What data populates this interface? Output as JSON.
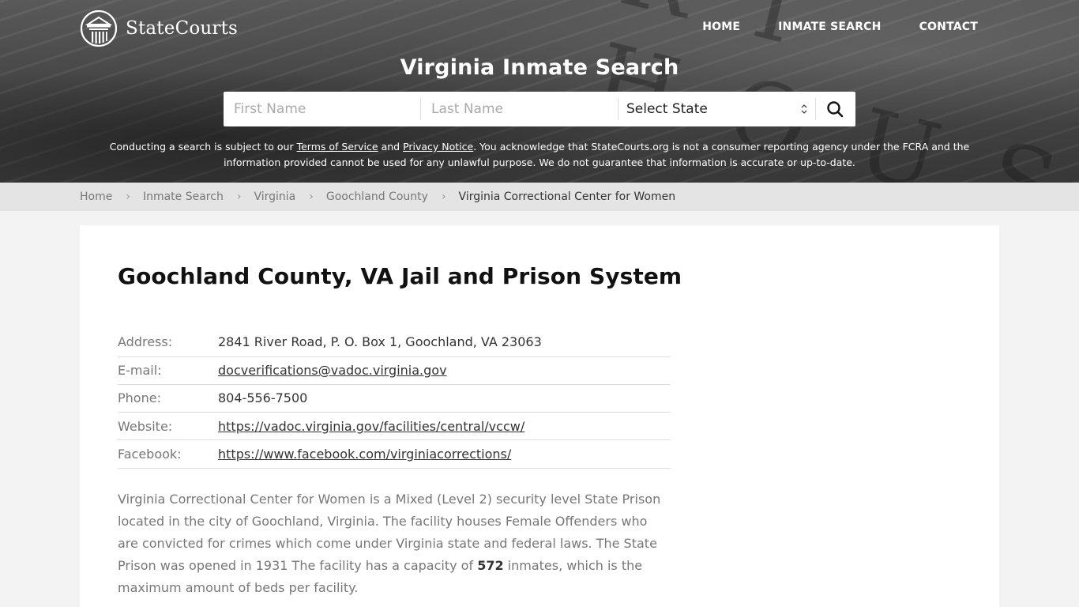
{
  "brand": {
    "name": "StateCourts",
    "logo_icon": "courthouse-columns-icon"
  },
  "nav": {
    "items": [
      {
        "label": "HOME"
      },
      {
        "label": "INMATE SEARCH"
      },
      {
        "label": "CONTACT"
      }
    ]
  },
  "hero": {
    "title": "Virginia Inmate Search",
    "decorative_text": "RT HOUSE"
  },
  "search": {
    "first_name_placeholder": "First Name",
    "first_name_value": "",
    "last_name_placeholder": "Last Name",
    "last_name_value": "",
    "state_selected": "Select State",
    "state_icon": "select-updown-icon",
    "search_icon": "search-icon"
  },
  "disclaimer": {
    "part1": "Conducting a search is subject to our ",
    "terms_link": "Terms of Service",
    "part2": " and ",
    "privacy_link": "Privacy Notice",
    "part3": ". You acknowledge that StateCourts.org is not a consumer reporting agency under the FCRA and the information provided cannot be used for any unlawful purpose. We do not guarantee that information is accurate or up-to-date."
  },
  "breadcrumb": {
    "items": [
      {
        "label": "Home"
      },
      {
        "label": "Inmate Search"
      },
      {
        "label": "Virginia"
      },
      {
        "label": "Goochland County"
      }
    ],
    "current": "Virginia Correctional Center for Women",
    "separator_icon": "chevron-right-icon"
  },
  "main": {
    "title": "Goochland County, VA Jail and Prison System",
    "info": [
      {
        "label": "Address:",
        "value": "2841 River Road, P. O. Box 1, Goochland, VA 23063",
        "link": false
      },
      {
        "label": "E-mail:",
        "value": "docverifications@vadoc.virginia.gov",
        "link": true
      },
      {
        "label": "Phone:",
        "value": "804-556-7500",
        "link": false
      },
      {
        "label": "Website:",
        "value": "https://vadoc.virginia.gov/facilities/central/vccw/",
        "link": true
      },
      {
        "label": "Facebook:",
        "value": "https://www.facebook.com/virginiacorrections/",
        "link": true
      }
    ],
    "description": {
      "before_capacity": "Virginia Correctional Center for Women is a Mixed (Level 2) security level State Prison located in the city of Goochland, Virginia. The facility houses Female Offenders who are convicted for crimes which come under Virginia state and federal laws. The State Prison was opened in 1931 The facility has a capacity of ",
      "capacity": "572",
      "after_capacity": " inmates, which is the maximum amount of beds per facility."
    }
  }
}
